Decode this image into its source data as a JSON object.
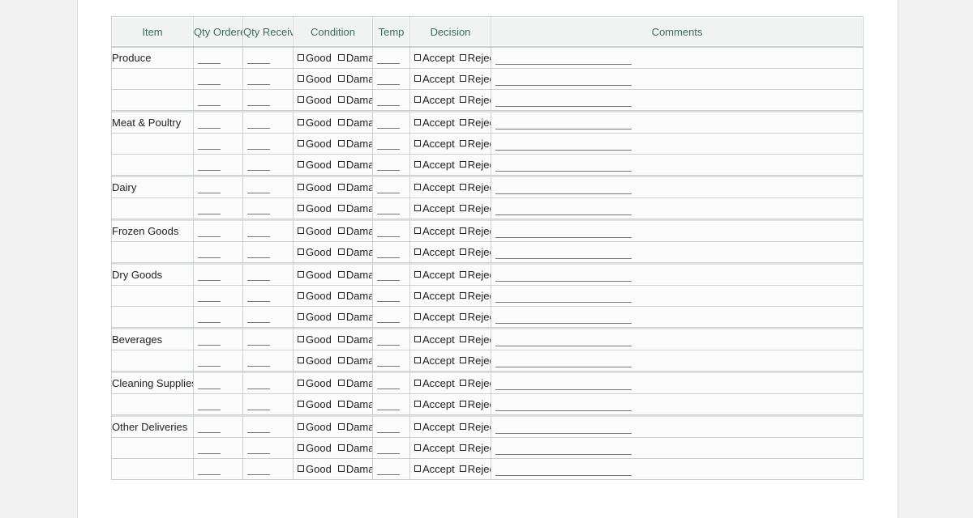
{
  "columns": [
    "Item",
    "Qty Ordered",
    "Qty Received",
    "Condition",
    "Temp",
    "Decision",
    "Comments"
  ],
  "options": {
    "condition_good": "Good",
    "condition_damaged": "Damaged",
    "decision_accept": "Accept",
    "decision_reject": "Reject"
  },
  "groups": [
    {
      "item": "Produce",
      "rows": 3
    },
    {
      "item": "Meat & Poultry",
      "rows": 3
    },
    {
      "item": "Dairy",
      "rows": 2
    },
    {
      "item": "Frozen Goods",
      "rows": 2
    },
    {
      "item": "Dry Goods",
      "rows": 3
    },
    {
      "item": "Beverages",
      "rows": 2
    },
    {
      "item": "Cleaning Supplies",
      "rows": 2
    },
    {
      "item": "Other Deliveries",
      "rows": 3
    }
  ]
}
